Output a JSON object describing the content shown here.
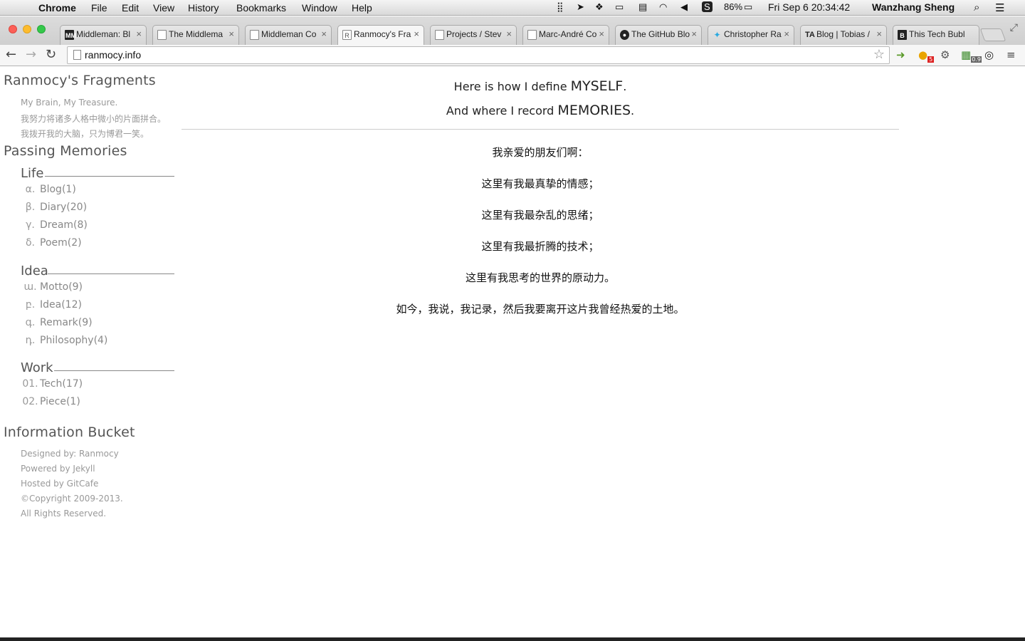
{
  "menubar": {
    "app": "Chrome",
    "items": [
      "File",
      "Edit",
      "View",
      "History",
      "Bookmarks",
      "Window",
      "Help"
    ],
    "battery": "86%",
    "datetime": "Fri Sep 6  20:34:42",
    "user": "Wanzhang Sheng"
  },
  "tabs": [
    {
      "title": "Middleman: Bl",
      "favicon": "MM"
    },
    {
      "title": "The Middlema",
      "favicon": ""
    },
    {
      "title": "Middleman Co",
      "favicon": ""
    },
    {
      "title": "Ranmocy's Fra",
      "favicon": "R"
    },
    {
      "title": "Projects / Stev",
      "favicon": ""
    },
    {
      "title": "Marc-André Co",
      "favicon": ""
    },
    {
      "title": "The GitHub Blo",
      "favicon": "github"
    },
    {
      "title": "Christopher Ra",
      "favicon": "twitter"
    },
    {
      "title": "Blog | Tobias /",
      "favicon": "TA"
    },
    {
      "title": "This Tech Bubl",
      "favicon": "B"
    }
  ],
  "toolbar": {
    "url": "ranmocy.info",
    "ext_badge_1": "5",
    "ext_badge_2": "0.9"
  },
  "sidebar": {
    "site_title": "Ranmocy's Fragments",
    "tagline": [
      "My Brain, My Treasure.",
      "我努力将诸多人格中微小的片面拼合。",
      "我拨开我的大脑，只为博君一笑。"
    ],
    "passing_title": "Passing Memories",
    "sections": [
      {
        "title": "Life",
        "items": [
          {
            "num": "α.",
            "label": "Blog(1)"
          },
          {
            "num": "β.",
            "label": "Diary(20)"
          },
          {
            "num": "γ.",
            "label": "Dream(8)"
          },
          {
            "num": "δ.",
            "label": "Poem(2)"
          }
        ]
      },
      {
        "title": "Idea",
        "items": [
          {
            "num": "ա.",
            "label": "Motto(9)"
          },
          {
            "num": "բ.",
            "label": "Idea(12)"
          },
          {
            "num": "գ.",
            "label": "Remark(9)"
          },
          {
            "num": "դ.",
            "label": "Philosophy(4)"
          }
        ]
      },
      {
        "title": "Work",
        "items": [
          {
            "num": "01.",
            "label": "Tech(17)"
          },
          {
            "num": "02.",
            "label": "Piece(1)"
          }
        ]
      }
    ],
    "info_title": "Information Bucket",
    "info": [
      "Designed by: Ranmocy",
      "Powered by Jekyll",
      "Hosted by GitCafe",
      "©Copyright 2009-2013.",
      "All Rights Reserved."
    ]
  },
  "main": {
    "line1_pre": "Here is how I define ",
    "line1_big": "MYSELF",
    "line1_post": ".",
    "line2_pre": "And where I record ",
    "line2_big": "MEMORIES",
    "line2_post": ".",
    "paragraphs": [
      "我亲爱的朋友们啊：",
      "这里有我最真挚的情感；",
      "这里有我最杂乱的思绪；",
      "这里有我最折腾的技术；",
      "这里有我思考的世界的原动力。",
      "如今，我说，我记录，然后我要离开这片我曾经热爱的土地。"
    ]
  }
}
